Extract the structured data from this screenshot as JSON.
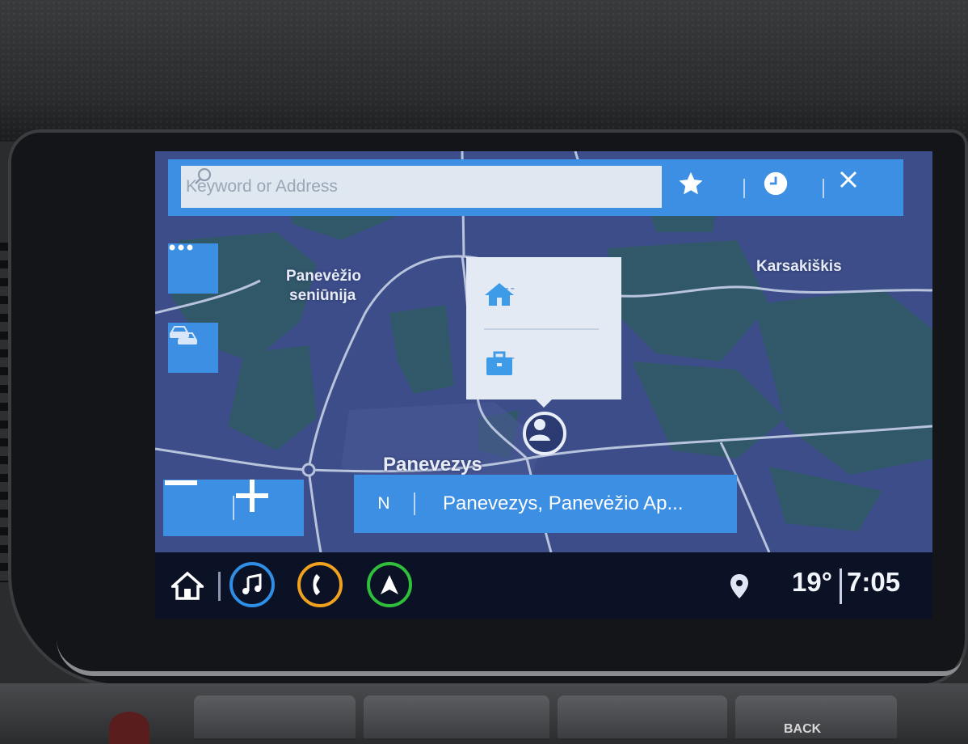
{
  "search": {
    "placeholder": "Keyword or Address"
  },
  "toolbar": {
    "favorites_icon": "star-icon",
    "recent_icon": "clock-icon",
    "close_icon": "close-icon"
  },
  "map": {
    "labels": {
      "panevezio_line1": "Panevėžio",
      "panevezio_line2": "seniūnija",
      "karsakiskis": "Karsakiškis",
      "panevezys": "Panevezys"
    }
  },
  "popup": {
    "home_value": "---",
    "work_value": "---"
  },
  "location_bar": {
    "heading": "N",
    "address": "Panevezys, Panevėžio Ap..."
  },
  "status": {
    "temperature": "19°",
    "time": "7:05"
  },
  "hardware": {
    "back_label": "BACK"
  },
  "colors": {
    "accent": "#3d8fe3",
    "map_bg": "#3c4d8a",
    "music_ring": "#2f8fe6",
    "phone_ring": "#f0a21e",
    "nav_ring": "#2fbf3a"
  }
}
